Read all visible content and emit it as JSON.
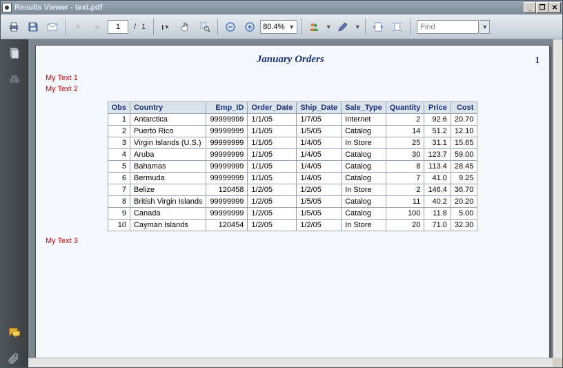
{
  "window": {
    "title": "Results Viewer - text.pdf",
    "min": "_",
    "restore": "❐",
    "close": "✕"
  },
  "toolbar": {
    "page_current": "1",
    "page_sep": "/",
    "page_total": "1",
    "zoom": "80.4%",
    "find_placeholder": "Find"
  },
  "document": {
    "title": "January Orders",
    "page_number": "1",
    "annotations": {
      "top1": "My Text 1",
      "top2": "My Text 2",
      "bottom": "My Text 3"
    },
    "columns": [
      "Obs",
      "Country",
      "Emp_ID",
      "Order_Date",
      "Ship_Date",
      "Sale_Type",
      "Quantity",
      "Price",
      "Cost"
    ],
    "rows": [
      {
        "obs": "1",
        "country": "Antarctica",
        "emp_id": "99999999",
        "order_date": "1/1/05",
        "ship_date": "1/7/05",
        "sale_type": "Internet",
        "quantity": "2",
        "price": "92.6",
        "cost": "20.70"
      },
      {
        "obs": "2",
        "country": "Puerto Rico",
        "emp_id": "99999999",
        "order_date": "1/1/05",
        "ship_date": "1/5/05",
        "sale_type": "Catalog",
        "quantity": "14",
        "price": "51.2",
        "cost": "12.10"
      },
      {
        "obs": "3",
        "country": "Virgin Islands (U.S.)",
        "emp_id": "99999999",
        "order_date": "1/1/05",
        "ship_date": "1/4/05",
        "sale_type": "In Store",
        "quantity": "25",
        "price": "31.1",
        "cost": "15.65"
      },
      {
        "obs": "4",
        "country": "Aruba",
        "emp_id": "99999999",
        "order_date": "1/1/05",
        "ship_date": "1/4/05",
        "sale_type": "Catalog",
        "quantity": "30",
        "price": "123.7",
        "cost": "59.00"
      },
      {
        "obs": "5",
        "country": "Bahamas",
        "emp_id": "99999999",
        "order_date": "1/1/05",
        "ship_date": "1/4/05",
        "sale_type": "Catalog",
        "quantity": "8",
        "price": "113.4",
        "cost": "28.45"
      },
      {
        "obs": "6",
        "country": "Bermuda",
        "emp_id": "99999999",
        "order_date": "1/1/05",
        "ship_date": "1/4/05",
        "sale_type": "Catalog",
        "quantity": "7",
        "price": "41.0",
        "cost": "9.25"
      },
      {
        "obs": "7",
        "country": "Belize",
        "emp_id": "120458",
        "order_date": "1/2/05",
        "ship_date": "1/2/05",
        "sale_type": "In Store",
        "quantity": "2",
        "price": "146.4",
        "cost": "36.70"
      },
      {
        "obs": "8",
        "country": "British Virgin Islands",
        "emp_id": "99999999",
        "order_date": "1/2/05",
        "ship_date": "1/5/05",
        "sale_type": "Catalog",
        "quantity": "11",
        "price": "40.2",
        "cost": "20.20"
      },
      {
        "obs": "9",
        "country": "Canada",
        "emp_id": "99999999",
        "order_date": "1/2/05",
        "ship_date": "1/5/05",
        "sale_type": "Catalog",
        "quantity": "100",
        "price": "11.8",
        "cost": "5.00"
      },
      {
        "obs": "10",
        "country": "Cayman Islands",
        "emp_id": "120454",
        "order_date": "1/2/05",
        "ship_date": "1/2/05",
        "sale_type": "In Store",
        "quantity": "20",
        "price": "71.0",
        "cost": "32.30"
      }
    ]
  }
}
